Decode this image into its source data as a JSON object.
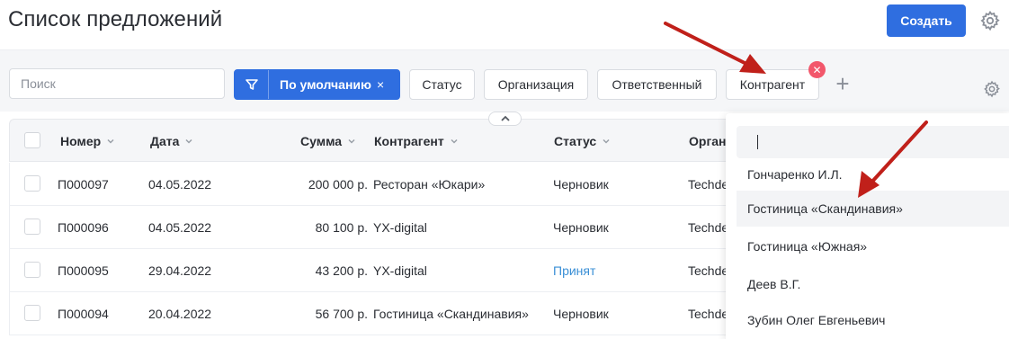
{
  "header": {
    "title": "Список предложений",
    "create_label": "Создать"
  },
  "filters": {
    "search_placeholder": "Поиск",
    "default_label": "По умолчанию",
    "clear_icon": "×",
    "remove_icon": "✕",
    "add_icon": "+",
    "chips": [
      "Статус",
      "Организация",
      "Ответственный",
      "Контрагент"
    ]
  },
  "table": {
    "columns": [
      "Номер",
      "Дата",
      "Сумма",
      "Контрагент",
      "Статус",
      "Организация"
    ],
    "visible_org_header": "Орган",
    "rows": [
      {
        "number": "П000097",
        "date": "04.05.2022",
        "sum": "200 000 р.",
        "counterparty": "Ресторан «Юкари»",
        "status": "Черновик",
        "org": "Techde"
      },
      {
        "number": "П000096",
        "date": "04.05.2022",
        "sum": "80 100 р.",
        "counterparty": "YX-digital",
        "status": "Черновик",
        "org": "Techdes"
      },
      {
        "number": "П000095",
        "date": "29.04.2022",
        "sum": "43 200 р.",
        "counterparty": "YX-digital",
        "status": "Принят",
        "org": "Techdes"
      },
      {
        "number": "П000094",
        "date": "20.04.2022",
        "sum": "56 700 р.",
        "counterparty": "Гостиница «Скандинавия»",
        "status": "Черновик",
        "org": "Techdes"
      }
    ]
  },
  "dropdown": {
    "search_value": "",
    "items": [
      "Гончаренко И.Л.",
      "Гостиница «Скандинавия»",
      "Гостиница «Южная»",
      "Деев В.Г.",
      "Зубин Олег Евгеньевич"
    ],
    "highlighted_index": 1
  },
  "colors": {
    "primary": "#2f6ee0",
    "danger": "#f2576b",
    "arrow": "#c0201a",
    "accepted": "#3a8fd6"
  }
}
